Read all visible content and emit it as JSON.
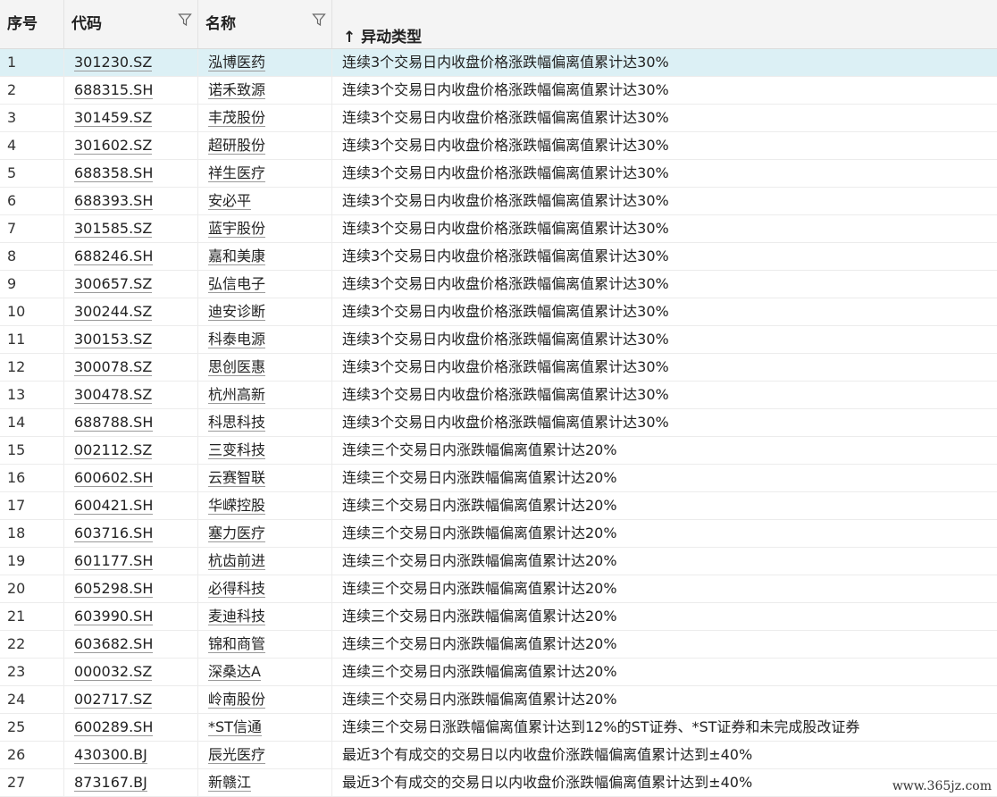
{
  "columns": {
    "index": "序号",
    "code": "代码",
    "name": "名称",
    "type": "异动类型",
    "sort_indicator": "↑"
  },
  "icons": {
    "filter": "filter-icon",
    "sort": "sort-up-arrow"
  },
  "selected_row": 1,
  "rows": [
    {
      "idx": "1",
      "code": "301230.SZ",
      "name": "泓博医药",
      "type": "连续3个交易日内收盘价格涨跌幅偏离值累计达30%"
    },
    {
      "idx": "2",
      "code": "688315.SH",
      "name": "诺禾致源",
      "type": "连续3个交易日内收盘价格涨跌幅偏离值累计达30%"
    },
    {
      "idx": "3",
      "code": "301459.SZ",
      "name": "丰茂股份",
      "type": "连续3个交易日内收盘价格涨跌幅偏离值累计达30%"
    },
    {
      "idx": "4",
      "code": "301602.SZ",
      "name": "超研股份",
      "type": "连续3个交易日内收盘价格涨跌幅偏离值累计达30%"
    },
    {
      "idx": "5",
      "code": "688358.SH",
      "name": "祥生医疗",
      "type": "连续3个交易日内收盘价格涨跌幅偏离值累计达30%"
    },
    {
      "idx": "6",
      "code": "688393.SH",
      "name": "安必平",
      "type": "连续3个交易日内收盘价格涨跌幅偏离值累计达30%"
    },
    {
      "idx": "7",
      "code": "301585.SZ",
      "name": "蓝宇股份",
      "type": "连续3个交易日内收盘价格涨跌幅偏离值累计达30%"
    },
    {
      "idx": "8",
      "code": "688246.SH",
      "name": "嘉和美康",
      "type": "连续3个交易日内收盘价格涨跌幅偏离值累计达30%"
    },
    {
      "idx": "9",
      "code": "300657.SZ",
      "name": "弘信电子",
      "type": "连续3个交易日内收盘价格涨跌幅偏离值累计达30%"
    },
    {
      "idx": "10",
      "code": "300244.SZ",
      "name": "迪安诊断",
      "type": "连续3个交易日内收盘价格涨跌幅偏离值累计达30%"
    },
    {
      "idx": "11",
      "code": "300153.SZ",
      "name": "科泰电源",
      "type": "连续3个交易日内收盘价格涨跌幅偏离值累计达30%"
    },
    {
      "idx": "12",
      "code": "300078.SZ",
      "name": "思创医惠",
      "type": "连续3个交易日内收盘价格涨跌幅偏离值累计达30%"
    },
    {
      "idx": "13",
      "code": "300478.SZ",
      "name": "杭州高新",
      "type": "连续3个交易日内收盘价格涨跌幅偏离值累计达30%"
    },
    {
      "idx": "14",
      "code": "688788.SH",
      "name": "科思科技",
      "type": "连续3个交易日内收盘价格涨跌幅偏离值累计达30%"
    },
    {
      "idx": "15",
      "code": "002112.SZ",
      "name": "三变科技",
      "type": "连续三个交易日内涨跌幅偏离值累计达20%"
    },
    {
      "idx": "16",
      "code": "600602.SH",
      "name": "云赛智联",
      "type": "连续三个交易日内涨跌幅偏离值累计达20%"
    },
    {
      "idx": "17",
      "code": "600421.SH",
      "name": "华嵘控股",
      "type": "连续三个交易日内涨跌幅偏离值累计达20%"
    },
    {
      "idx": "18",
      "code": "603716.SH",
      "name": "塞力医疗",
      "type": "连续三个交易日内涨跌幅偏离值累计达20%"
    },
    {
      "idx": "19",
      "code": "601177.SH",
      "name": "杭齿前进",
      "type": "连续三个交易日内涨跌幅偏离值累计达20%"
    },
    {
      "idx": "20",
      "code": "605298.SH",
      "name": "必得科技",
      "type": "连续三个交易日内涨跌幅偏离值累计达20%"
    },
    {
      "idx": "21",
      "code": "603990.SH",
      "name": "麦迪科技",
      "type": "连续三个交易日内涨跌幅偏离值累计达20%"
    },
    {
      "idx": "22",
      "code": "603682.SH",
      "name": "锦和商管",
      "type": "连续三个交易日内涨跌幅偏离值累计达20%"
    },
    {
      "idx": "23",
      "code": "000032.SZ",
      "name": "深桑达A",
      "type": "连续三个交易日内涨跌幅偏离值累计达20%"
    },
    {
      "idx": "24",
      "code": "002717.SZ",
      "name": "岭南股份",
      "type": "连续三个交易日内涨跌幅偏离值累计达20%"
    },
    {
      "idx": "25",
      "code": "600289.SH",
      "name": "*ST信通",
      "type": "连续三个交易日涨跌幅偏离值累计达到12%的ST证券、*ST证券和未完成股改证券"
    },
    {
      "idx": "26",
      "code": "430300.BJ",
      "name": "辰光医疗",
      "type": "最近3个有成交的交易日以内收盘价涨跌幅偏离值累计达到±40%"
    },
    {
      "idx": "27",
      "code": "873167.BJ",
      "name": "新赣江",
      "type": "最近3个有成交的交易日以内收盘价涨跌幅偏离值累计达到±40%"
    }
  ],
  "watermark": "www.365jz.com"
}
